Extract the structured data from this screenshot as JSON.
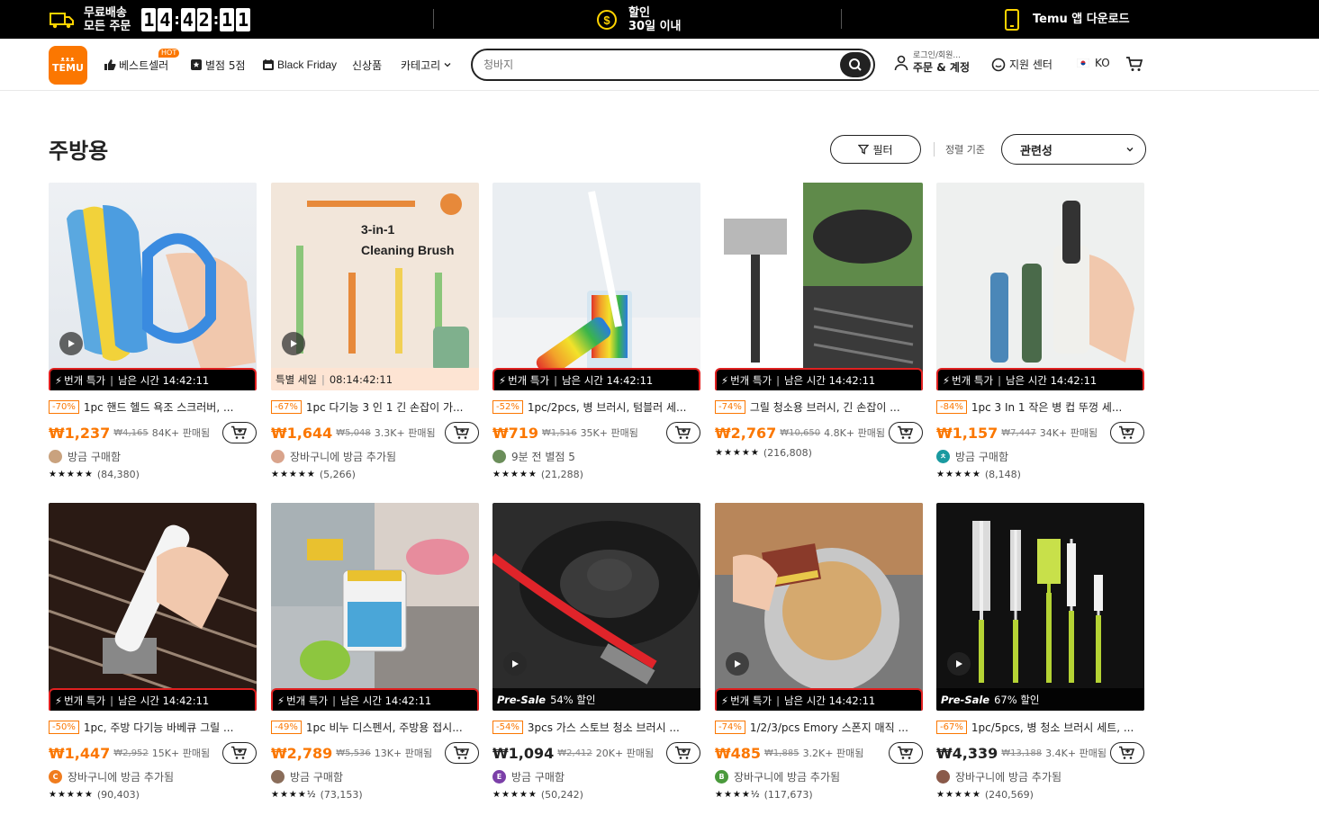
{
  "promo": {
    "shipping_line1": "무료배송",
    "shipping_line2": "모든 주문",
    "timer": [
      "1",
      "4",
      "4",
      "2",
      "1",
      "1"
    ],
    "discount_line1": "할인",
    "discount_line2": "30일 이내",
    "app": "Temu 앱 다운로드"
  },
  "header": {
    "logo_top": "ᴥᴥᴥ",
    "logo_text": "TEMU",
    "nav": {
      "bestseller": "베스트셀러",
      "hot": "HOT",
      "five_star": "별점 5점",
      "black_friday": "Black Friday",
      "new": "신상품",
      "category": "카테고리"
    },
    "search_placeholder": "청바지",
    "login_small": "로그인/회원...",
    "login_big": "주문 & 계정",
    "support": "지원 센터",
    "lang": "KO"
  },
  "main": {
    "title": "주방용",
    "filter": "필터",
    "sort_label": "정렬 기준",
    "sort_value": "관련성"
  },
  "colors": {
    "brand": "#fb7701",
    "flash_red": "#e02020"
  },
  "products": [
    {
      "banner_type": "flash",
      "banner_a": "번개 특가",
      "banner_b": "남은 시간 14:42:11",
      "discount": "-70%",
      "title": "1pc 핸드 헬드 욕조 스크러버, ...",
      "price": "₩1,237",
      "orig": "₩4,165",
      "sold": "84K+ 판매됨",
      "buyer": "방금 구매함",
      "rating": "(84,380)",
      "stars": "★★★★★",
      "video": true,
      "avatar_color": "#c9a27e",
      "avatar_letter": ""
    },
    {
      "banner_type": "sale",
      "banner_a": "특별 세일",
      "banner_b": "08:14:42:11",
      "discount": "-67%",
      "title": "1pc 다기능 3 인 1 긴 손잡이 가...",
      "price": "₩1,644",
      "orig": "₩5,048",
      "sold": "3.3K+ 판매됨",
      "buyer": "장바구니에 방금 추가됨",
      "rating": "(5,266)",
      "stars": "★★★★★",
      "video": true,
      "avatar_color": "#d9a48c",
      "avatar_letter": ""
    },
    {
      "banner_type": "flash",
      "banner_a": "번개 특가",
      "banner_b": "남은 시간 14:42:11",
      "discount": "-52%",
      "title": "1pc/2pcs, 병 브러시, 텀블러 세...",
      "price": "₩719",
      "orig": "₩1,516",
      "sold": "35K+ 판매됨",
      "buyer": "9분 전 별점 5",
      "rating": "(21,288)",
      "stars": "★★★★★",
      "video": false,
      "avatar_color": "#6b8e5a",
      "avatar_letter": ""
    },
    {
      "banner_type": "flash",
      "banner_a": "번개 특가",
      "banner_b": "남은 시간 14:42:11",
      "discount": "-74%",
      "title": "그릴 청소용 브러시, 긴 손잡이 ...",
      "price": "₩2,767",
      "orig": "₩10,650",
      "sold": "4.8K+ 판매됨",
      "buyer": "",
      "rating": "(216,808)",
      "stars": "★★★★★",
      "video": false,
      "avatar_color": "",
      "avatar_letter": ""
    },
    {
      "banner_type": "flash",
      "banner_a": "번개 특가",
      "banner_b": "남은 시간 14:42:11",
      "discount": "-84%",
      "title": "1pc 3 In 1 작은 병 컵 뚜껑 세...",
      "price": "₩1,157",
      "orig": "₩7,447",
      "sold": "34K+ 판매됨",
      "buyer": "방금 구매함",
      "rating": "(8,148)",
      "stars": "★★★★★",
      "video": false,
      "avatar_color": "#1a9aa0",
      "avatar_letter": "ㅊ"
    },
    {
      "banner_type": "flash",
      "banner_a": "번개 특가",
      "banner_b": "남은 시간 14:42:11",
      "discount": "-50%",
      "title": "1pc, 주방 다기능 바베큐 그릴 ...",
      "price": "₩1,447",
      "orig": "₩2,952",
      "sold": "15K+ 판매됨",
      "buyer": "장바구니에 방금 추가됨",
      "rating": "(90,403)",
      "stars": "★★★★★",
      "video": false,
      "avatar_color": "#f07c1e",
      "avatar_letter": "C"
    },
    {
      "banner_type": "flash",
      "banner_a": "번개 특가",
      "banner_b": "남은 시간 14:42:11",
      "discount": "-49%",
      "title": "1pc 비누 디스펜서, 주방용 접시...",
      "price": "₩2,789",
      "orig": "₩5,536",
      "sold": "13K+ 판매됨",
      "buyer": "방금 구매함",
      "rating": "(73,153)",
      "stars": "★★★★½",
      "video": false,
      "avatar_color": "#8a6d5a",
      "avatar_letter": ""
    },
    {
      "banner_type": "presale",
      "banner_a": "Pre-Sale",
      "banner_b": "54% 할인",
      "discount": "-54%",
      "title": "3pcs 가스 스토브 청소 브러시 ...",
      "price": "₩1,094",
      "orig": "₩2,412",
      "sold": "20K+ 판매됨",
      "buyer": "방금 구매함",
      "rating": "(50,242)",
      "stars": "★★★★★",
      "video": true,
      "avatar_color": "#7b3fa8",
      "avatar_letter": "E"
    },
    {
      "banner_type": "flash",
      "banner_a": "번개 특가",
      "banner_b": "남은 시간 14:42:11",
      "discount": "-74%",
      "title": "1/2/3/pcs Emory 스폰지 매직 ...",
      "price": "₩485",
      "orig": "₩1,885",
      "sold": "3.2K+ 판매됨",
      "buyer": "장바구니에 방금 추가됨",
      "rating": "(117,673)",
      "stars": "★★★★½",
      "video": true,
      "avatar_color": "#4a9a3c",
      "avatar_letter": "B"
    },
    {
      "banner_type": "presale",
      "banner_a": "Pre-Sale",
      "banner_b": "67% 할인",
      "discount": "-67%",
      "title": "1pc/5pcs, 병 청소 브러시 세트, ...",
      "price": "₩4,339",
      "orig": "₩13,188",
      "sold": "3.4K+ 판매됨",
      "buyer": "장바구니에 방금 추가됨",
      "rating": "(240,569)",
      "stars": "★★★★★",
      "video": true,
      "avatar_color": "#8a5a4a",
      "avatar_letter": ""
    }
  ]
}
